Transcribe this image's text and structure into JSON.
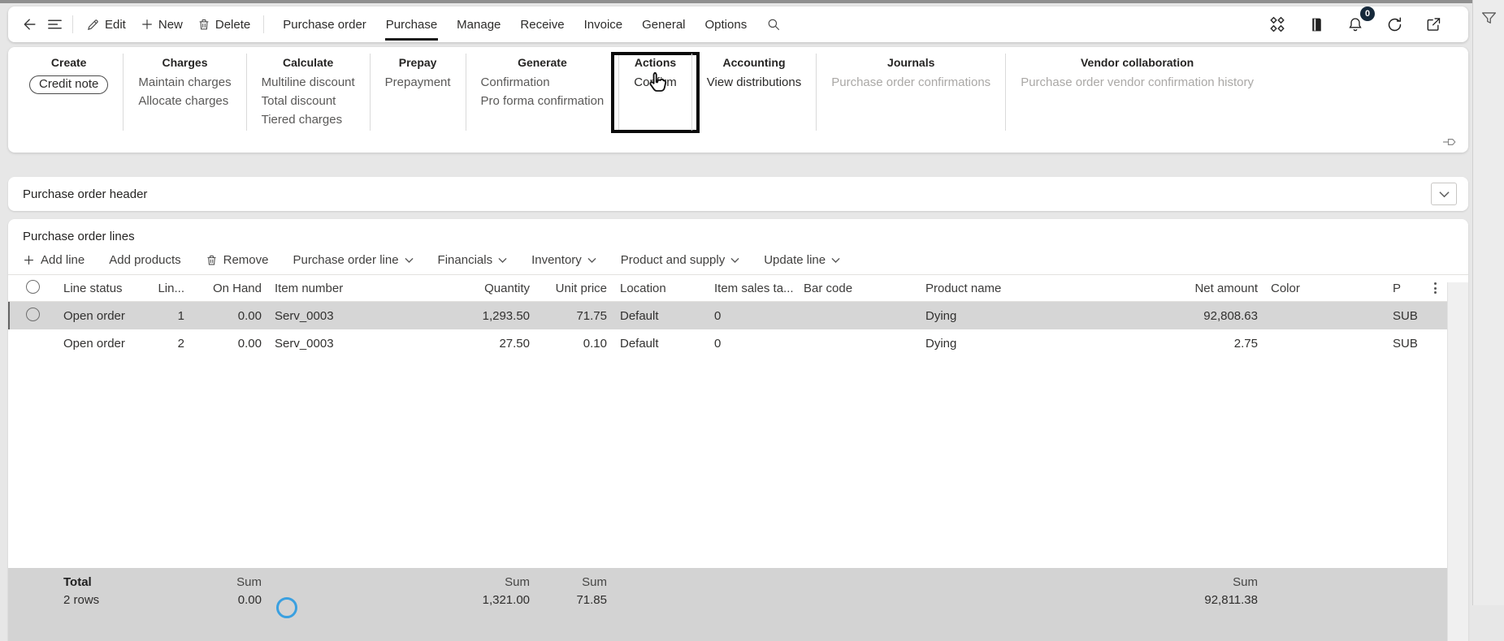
{
  "appbar": {
    "edit_label": "Edit",
    "new_label": "New",
    "delete_label": "Delete",
    "tabs": [
      {
        "label": "Purchase order",
        "active": false
      },
      {
        "label": "Purchase",
        "active": true
      },
      {
        "label": "Manage",
        "active": false
      },
      {
        "label": "Receive",
        "active": false
      },
      {
        "label": "Invoice",
        "active": false
      },
      {
        "label": "General",
        "active": false
      },
      {
        "label": "Options",
        "active": false
      }
    ],
    "notification_count": "0"
  },
  "ribbon": {
    "groups": [
      {
        "title": "Create",
        "items": [
          {
            "label": "Credit note",
            "outlined": true,
            "emphasis": true
          }
        ]
      },
      {
        "title": "Charges",
        "items": [
          {
            "label": "Maintain charges"
          },
          {
            "label": "Allocate charges"
          }
        ]
      },
      {
        "title": "Calculate",
        "items": [
          {
            "label": "Multiline discount"
          },
          {
            "label": "Total discount"
          },
          {
            "label": "Tiered charges"
          }
        ]
      },
      {
        "title": "Prepay",
        "items": [
          {
            "label": "Prepayment"
          }
        ]
      },
      {
        "title": "Generate",
        "items": [
          {
            "label": "Confirmation"
          },
          {
            "label": "Pro forma confirmation"
          }
        ]
      },
      {
        "title": "Actions",
        "highlighted": true,
        "items": [
          {
            "label": "Confirm",
            "emphasis": true
          }
        ]
      },
      {
        "title": "Accounting",
        "items": [
          {
            "label": "View distributions",
            "emphasis": true
          }
        ]
      },
      {
        "title": "Journals",
        "items": [
          {
            "label": "Purchase order confirmations",
            "disabled": true
          }
        ]
      },
      {
        "title": "Vendor collaboration",
        "items": [
          {
            "label": "Purchase order vendor confirmation history",
            "disabled": true
          }
        ]
      }
    ]
  },
  "sections": {
    "header_title": "Purchase order header",
    "lines_title": "Purchase order lines"
  },
  "lines_toolbar": {
    "add_line": "Add line",
    "add_products": "Add products",
    "remove": "Remove",
    "menus": [
      "Purchase order line",
      "Financials",
      "Inventory",
      "Product and supply",
      "Update line"
    ]
  },
  "grid": {
    "columns": [
      "Line status",
      "Lin...",
      "On Hand",
      "Item number",
      "Quantity",
      "Unit price",
      "Location",
      "Item sales ta...",
      "Bar code",
      "Product name",
      "Net amount",
      "Color",
      "P"
    ],
    "rows": [
      {
        "selected": true,
        "line_status": "Open order",
        "line": "1",
        "on_hand": "0.00",
        "item_number": "Serv_0003",
        "quantity": "1,293.50",
        "unit_price": "71.75",
        "location": "Default",
        "item_sales_tax": "0",
        "bar_code": "",
        "product_name": "Dying",
        "net_amount": "92,808.63",
        "color": "",
        "p": "SUB"
      },
      {
        "selected": false,
        "line_status": "Open order",
        "line": "2",
        "on_hand": "0.00",
        "item_number": "Serv_0003",
        "quantity": "27.50",
        "unit_price": "0.10",
        "location": "Default",
        "item_sales_tax": "0",
        "bar_code": "",
        "product_name": "Dying",
        "net_amount": "2.75",
        "color": "",
        "p": "SUB"
      }
    ],
    "footer": {
      "total_label": "Total",
      "rows_count": "2 rows",
      "sum_label": "Sum",
      "on_hand_sum": "0.00",
      "quantity_sum": "1,321.00",
      "unit_price_sum": "71.85",
      "net_amount_sum": "92,811.38"
    }
  },
  "colors": {
    "selected_row": "#d6d6d6",
    "footer_bg": "#d3d3d3",
    "highlight_box": "#0a0a0a",
    "spinner_blue": "#3aa0e0",
    "active_tab_underline": "#1b1b1b"
  },
  "icons": {
    "ellipsis": "vertical-ellipsis",
    "cursor": "hand-pointer-over-confirm"
  }
}
